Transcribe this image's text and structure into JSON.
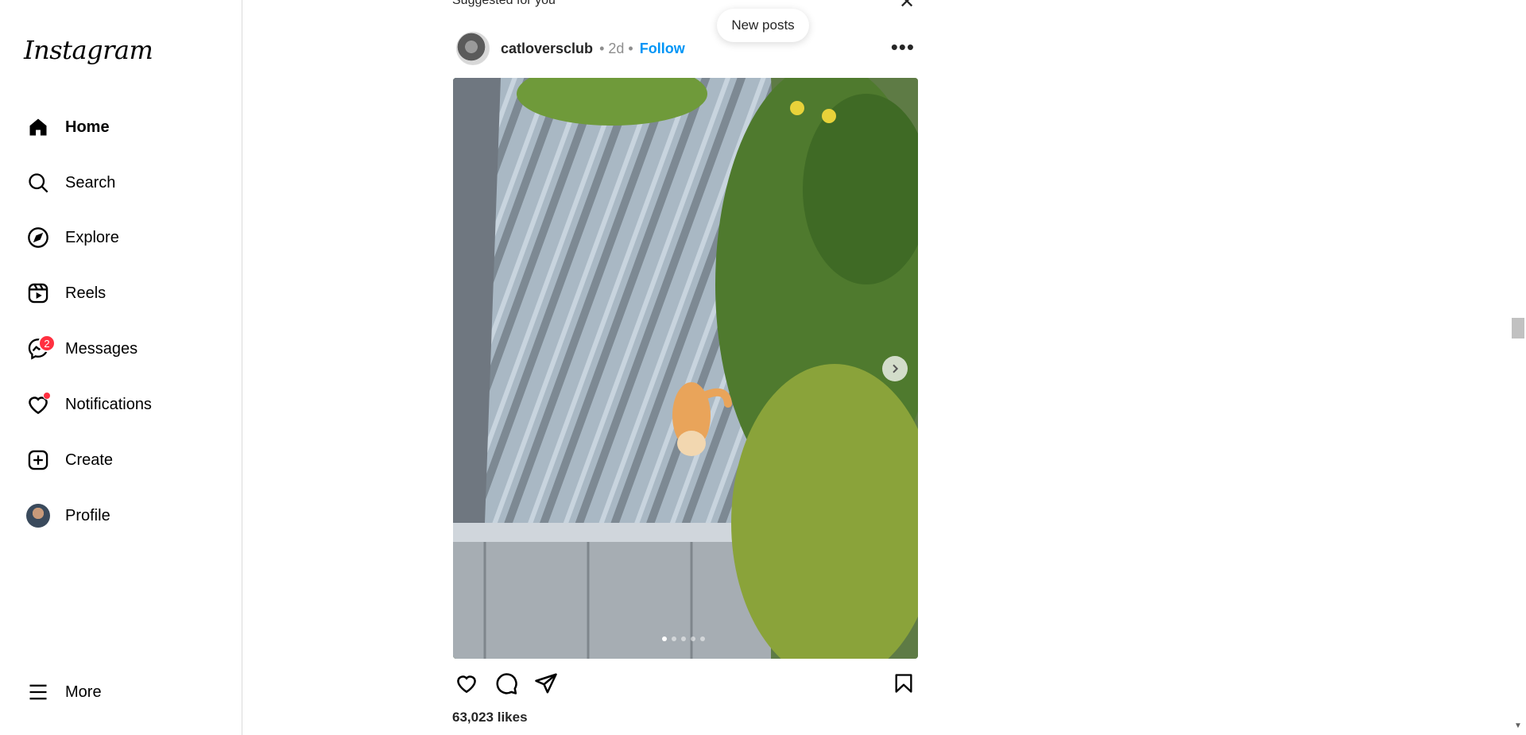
{
  "sidebar": {
    "logo": "Instagram",
    "items": [
      {
        "label": "Home",
        "icon": "home-icon"
      },
      {
        "label": "Search",
        "icon": "search-icon"
      },
      {
        "label": "Explore",
        "icon": "compass-icon"
      },
      {
        "label": "Reels",
        "icon": "reels-icon"
      },
      {
        "label": "Messages",
        "icon": "messenger-icon",
        "badge": "2"
      },
      {
        "label": "Notifications",
        "icon": "heart-icon"
      },
      {
        "label": "Create",
        "icon": "plus-square-icon"
      },
      {
        "label": "Profile",
        "icon": "avatar"
      }
    ],
    "more_label": "More"
  },
  "feed": {
    "section_title": "Suggested for you",
    "new_posts_label": "New posts",
    "post": {
      "username": "catloversclub",
      "meta": "• 2d •",
      "follow_label": "Follow",
      "media_description_icon": "photo",
      "carousel": {
        "count": 5,
        "active_index": 0
      },
      "likes": "63,023 likes"
    }
  },
  "colors": {
    "accent": "#0095f6",
    "badge": "#ff3040",
    "border": "#dbdbdb",
    "muted": "#8e8e8e"
  }
}
